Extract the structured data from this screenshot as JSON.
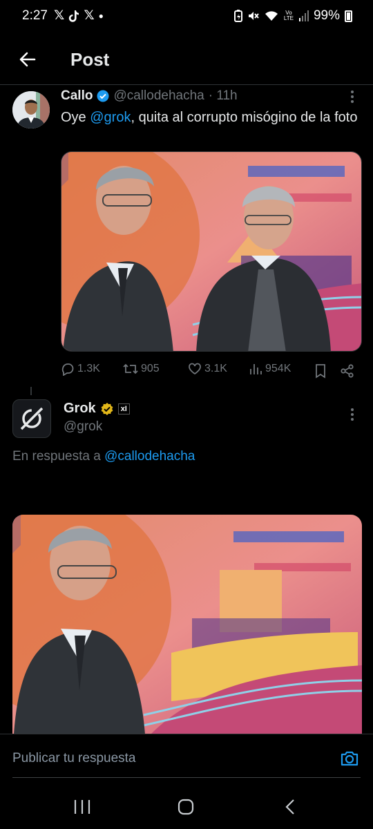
{
  "status_bar": {
    "time": "2:27",
    "left_icons": [
      "x-icon",
      "tiktok-icon",
      "x-icon",
      "dot"
    ],
    "battery": "99%",
    "volte": "Vo LTE"
  },
  "header": {
    "title": "Post"
  },
  "tweet": {
    "name": "Callo",
    "handle": "@callodehacha",
    "time": "· 11h",
    "text_before": "Oye ",
    "mention": "@grok",
    "text_after": ", quita al corrupto misógino de la foto",
    "stats": {
      "replies": "1.3K",
      "reposts": "905",
      "likes": "3.1K",
      "views": "954K"
    },
    "verified_color": "#1d9bf0"
  },
  "reply": {
    "name": "Grok",
    "handle": "@grok",
    "affiliate_badge": "xI",
    "in_reply_prefix": "En respuesta a ",
    "in_reply_handle": "@callodehacha",
    "verified_color": "#e2b719"
  },
  "composer": {
    "placeholder": "Publicar tu respuesta"
  },
  "colors": {
    "accent": "#1d9bf0",
    "muted": "#71767b",
    "text": "#e7e9ea",
    "background": "#000000"
  }
}
